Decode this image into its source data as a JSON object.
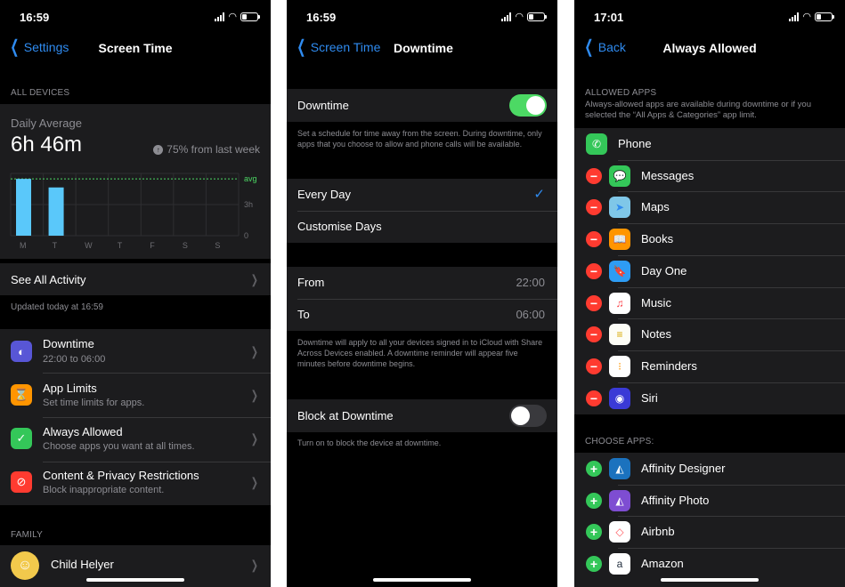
{
  "panels": {
    "screen_time": {
      "status": {
        "time": "16:59"
      },
      "nav": {
        "back": "Settings",
        "title": "Screen Time"
      },
      "all_devices_label": "ALL DEVICES",
      "daily_average_label": "Daily Average",
      "daily_average_value": "6h 46m",
      "trend_text": "75% from last week",
      "chart_data": {
        "type": "bar",
        "categories": [
          "M",
          "T",
          "W",
          "T",
          "F",
          "S",
          "S"
        ],
        "values": [
          7.3,
          6.2,
          0,
          0,
          0,
          0,
          0
        ],
        "avg_label": "avg",
        "avg_value": 7.3,
        "y_ticks": [
          "3h",
          "0"
        ],
        "ylim": [
          0,
          8
        ]
      },
      "see_all_activity": "See All Activity",
      "updated_text": "Updated today at 16:59",
      "menu": [
        {
          "title": "Downtime",
          "subtitle": "22:00 to 06:00",
          "icon": "moon-icon",
          "color": "#5856d6"
        },
        {
          "title": "App Limits",
          "subtitle": "Set time limits for apps.",
          "icon": "hourglass-icon",
          "color": "#ff9500"
        },
        {
          "title": "Always Allowed",
          "subtitle": "Choose apps you want at all times.",
          "icon": "checkmark-icon",
          "color": "#34c759"
        },
        {
          "title": "Content & Privacy Restrictions",
          "subtitle": "Block inappropriate content.",
          "icon": "restriction-icon",
          "color": "#ff3b30"
        }
      ],
      "family_label": "FAMILY",
      "family_member": "Child Helyer"
    },
    "downtime": {
      "status": {
        "time": "16:59"
      },
      "nav": {
        "back": "Screen Time",
        "title": "Downtime"
      },
      "downtime_label": "Downtime",
      "downtime_on": true,
      "description": "Set a schedule for time away from the screen. During downtime, only apps that you choose to allow and phone calls will be available.",
      "every_day": "Every Day",
      "customise_days": "Customise Days",
      "from_label": "From",
      "from_value": "22:00",
      "to_label": "To",
      "to_value": "06:00",
      "devices_note": "Downtime will apply to all your devices signed in to iCloud with Share Across Devices enabled. A downtime reminder will appear five minutes before downtime begins.",
      "block_label": "Block at Downtime",
      "block_on": false,
      "block_note": "Turn on to block the device at downtime."
    },
    "always_allowed": {
      "status": {
        "time": "17:01"
      },
      "nav": {
        "back": "Back",
        "title": "Always Allowed"
      },
      "allowed_label": "ALLOWED APPS",
      "allowed_desc": "Always-allowed apps are available during downtime or if you selected the “All Apps & Categories” app limit.",
      "phone": "Phone",
      "allowed_apps": [
        {
          "name": "Messages",
          "icon": "messages-icon",
          "color": "#34c759"
        },
        {
          "name": "Maps",
          "icon": "maps-icon",
          "color": "#7fc7e8"
        },
        {
          "name": "Books",
          "icon": "books-icon",
          "color": "#ff9500"
        },
        {
          "name": "Day One",
          "icon": "day-one-icon",
          "color": "#2e9cf4"
        },
        {
          "name": "Music",
          "icon": "music-icon",
          "color": "#ffffff"
        },
        {
          "name": "Notes",
          "icon": "notes-icon",
          "color": "#fdfdf6"
        },
        {
          "name": "Reminders",
          "icon": "reminders-icon",
          "color": "#ffffff"
        },
        {
          "name": "Siri",
          "icon": "siri-icon",
          "color": "#3a3ad6"
        }
      ],
      "choose_label": "CHOOSE APPS:",
      "choose_apps": [
        {
          "name": "Affinity Designer",
          "icon": "affinity-designer-icon",
          "color": "#1b72be"
        },
        {
          "name": "Affinity Photo",
          "icon": "affinity-photo-icon",
          "color": "#7e4dd2"
        },
        {
          "name": "Airbnb",
          "icon": "airbnb-icon",
          "color": "#ffffff"
        },
        {
          "name": "Amazon",
          "icon": "amazon-icon",
          "color": "#ffffff"
        }
      ]
    }
  }
}
